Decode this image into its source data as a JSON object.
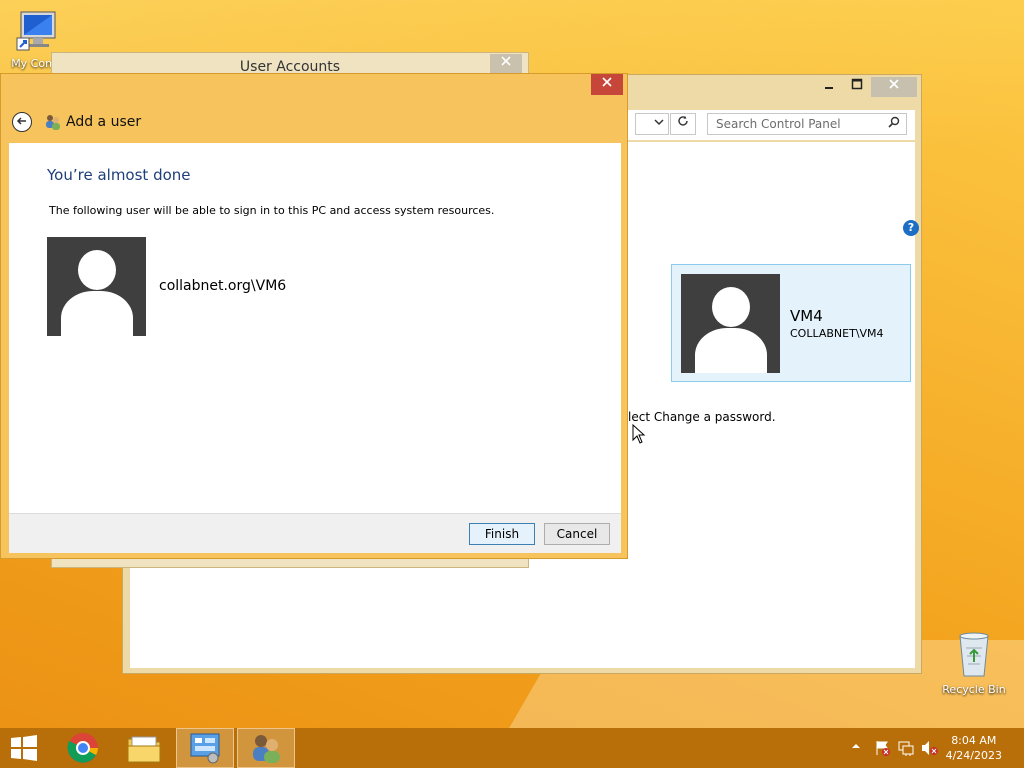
{
  "desktop": {
    "icons": [
      {
        "name": "my-computer",
        "label": "My Comp"
      },
      {
        "name": "recycle-bin",
        "label": "Recycle Bin"
      }
    ]
  },
  "control_panel": {
    "search_placeholder": "Search Control Panel",
    "user_card": {
      "name": "VM4",
      "domain": "COLLABNET\\VM4"
    },
    "hint_text": "lect Change a password."
  },
  "user_accounts": {
    "title": "User Accounts"
  },
  "dialog": {
    "title": "Add a user",
    "heading": "You’re almost done",
    "description": "The following user will be able to sign in to this PC and access system resources.",
    "user": "collabnet.org\\VM6",
    "finish_label": "Finish",
    "cancel_label": "Cancel"
  },
  "taskbar": {
    "time": "8:04 AM",
    "date": "4/24/2023"
  },
  "colors": {
    "desktop": "#f5ab24",
    "dialog_frame": "#f6c35c",
    "taskbar": "#b86f0a",
    "heading": "#1e3f7a"
  }
}
